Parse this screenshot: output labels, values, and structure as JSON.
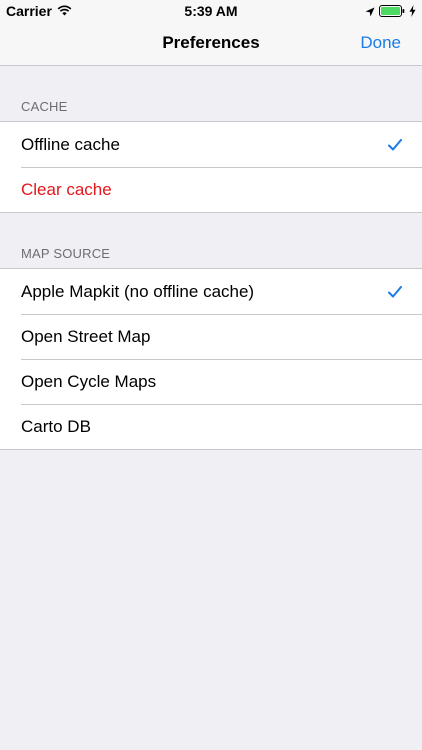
{
  "status_bar": {
    "carrier": "Carrier",
    "time": "5:39 AM"
  },
  "nav": {
    "title": "Preferences",
    "done_label": "Done"
  },
  "cache_section": {
    "header": "CACHE",
    "rows": [
      {
        "label": "Offline cache",
        "checked": true
      },
      {
        "label": "Clear cache"
      }
    ]
  },
  "map_source_section": {
    "header": "MAP SOURCE",
    "rows": [
      {
        "label": "Apple Mapkit (no offline cache)",
        "checked": true
      },
      {
        "label": "Open Street Map"
      },
      {
        "label": "Open Cycle Maps"
      },
      {
        "label": "Carto DB"
      }
    ]
  },
  "colors": {
    "accent": "#1a7ce4",
    "destructive": "#e3171c",
    "background": "#efeff4"
  },
  "icons": [
    "wifi-icon",
    "location-arrow-icon",
    "battery-icon",
    "charging-bolt-icon",
    "checkmark-icon"
  ]
}
